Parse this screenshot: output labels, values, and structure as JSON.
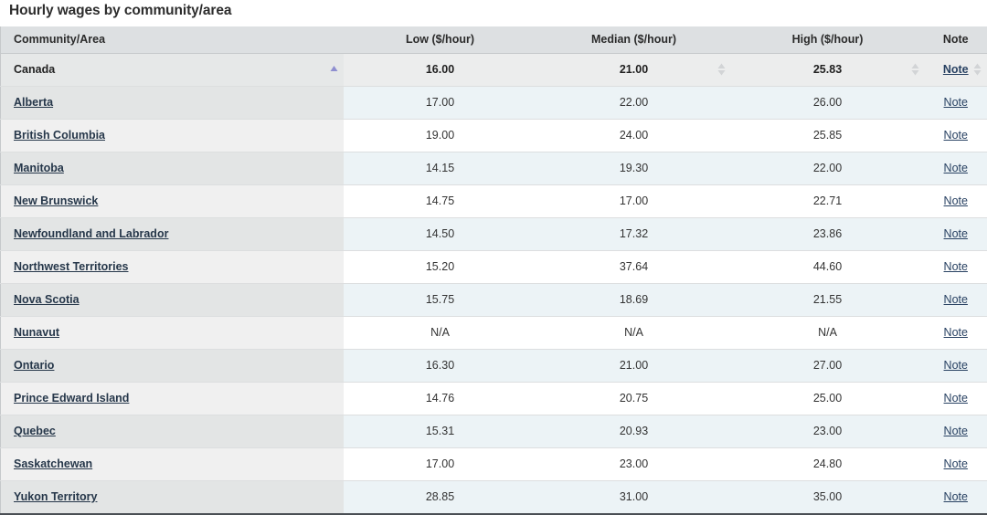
{
  "title": "Hourly wages by community/area",
  "table": {
    "columns": [
      {
        "key": "area",
        "label": "Community/Area",
        "align": "left"
      },
      {
        "key": "low",
        "label": "Low ($/hour)",
        "align": "center"
      },
      {
        "key": "median",
        "label": "Median ($/hour)",
        "align": "center"
      },
      {
        "key": "high",
        "label": "High ($/hour)",
        "align": "center"
      },
      {
        "key": "note",
        "label": "Note",
        "align": "center"
      }
    ],
    "note_label": "Note",
    "sort": {
      "active_column": "area",
      "direction": "ascending",
      "ascending_icon": "sort-ascending-icon",
      "unsorted_icon": "sort-unsorted-icon"
    },
    "rows": [
      {
        "area": "Canada",
        "is_link": false,
        "is_total": true,
        "low": "16.00",
        "median": "21.00",
        "high": "25.83",
        "note": "Note"
      },
      {
        "area": "Alberta",
        "is_link": true,
        "is_total": false,
        "low": "17.00",
        "median": "22.00",
        "high": "26.00",
        "note": "Note"
      },
      {
        "area": "British Columbia",
        "is_link": true,
        "is_total": false,
        "low": "19.00",
        "median": "24.00",
        "high": "25.85",
        "note": "Note"
      },
      {
        "area": "Manitoba",
        "is_link": true,
        "is_total": false,
        "low": "14.15",
        "median": "19.30",
        "high": "22.00",
        "note": "Note"
      },
      {
        "area": "New Brunswick",
        "is_link": true,
        "is_total": false,
        "low": "14.75",
        "median": "17.00",
        "high": "22.71",
        "note": "Note"
      },
      {
        "area": "Newfoundland and Labrador",
        "is_link": true,
        "is_total": false,
        "low": "14.50",
        "median": "17.32",
        "high": "23.86",
        "note": "Note"
      },
      {
        "area": "Northwest Territories",
        "is_link": true,
        "is_total": false,
        "low": "15.20",
        "median": "37.64",
        "high": "44.60",
        "note": "Note"
      },
      {
        "area": "Nova Scotia",
        "is_link": true,
        "is_total": false,
        "low": "15.75",
        "median": "18.69",
        "high": "21.55",
        "note": "Note"
      },
      {
        "area": "Nunavut",
        "is_link": true,
        "is_total": false,
        "low": "N/A",
        "median": "N/A",
        "high": "N/A",
        "note": "Note"
      },
      {
        "area": "Ontario",
        "is_link": true,
        "is_total": false,
        "low": "16.30",
        "median": "21.00",
        "high": "27.00",
        "note": "Note"
      },
      {
        "area": "Prince Edward Island",
        "is_link": true,
        "is_total": false,
        "low": "14.76",
        "median": "20.75",
        "high": "25.00",
        "note": "Note"
      },
      {
        "area": "Quebec",
        "is_link": true,
        "is_total": false,
        "low": "15.31",
        "median": "20.93",
        "high": "23.00",
        "note": "Note"
      },
      {
        "area": "Saskatchewan",
        "is_link": true,
        "is_total": false,
        "low": "17.00",
        "median": "23.00",
        "high": "24.80",
        "note": "Note"
      },
      {
        "area": "Yukon Territory",
        "is_link": true,
        "is_total": false,
        "low": "28.85",
        "median": "31.00",
        "high": "35.00",
        "note": "Note"
      }
    ]
  },
  "colors": {
    "header_bg": "#dde0e2",
    "stripe_blue": "#ecf3f6",
    "stripe_white": "#ffffff",
    "area_grey_dark": "#e3e5e5",
    "area_grey_light": "#f0f0f0",
    "link": "#26374a",
    "sort_active": "#8f8fd0",
    "sort_inactive": "#d2d4d6",
    "table_bottom_border": "#4a4f54"
  }
}
